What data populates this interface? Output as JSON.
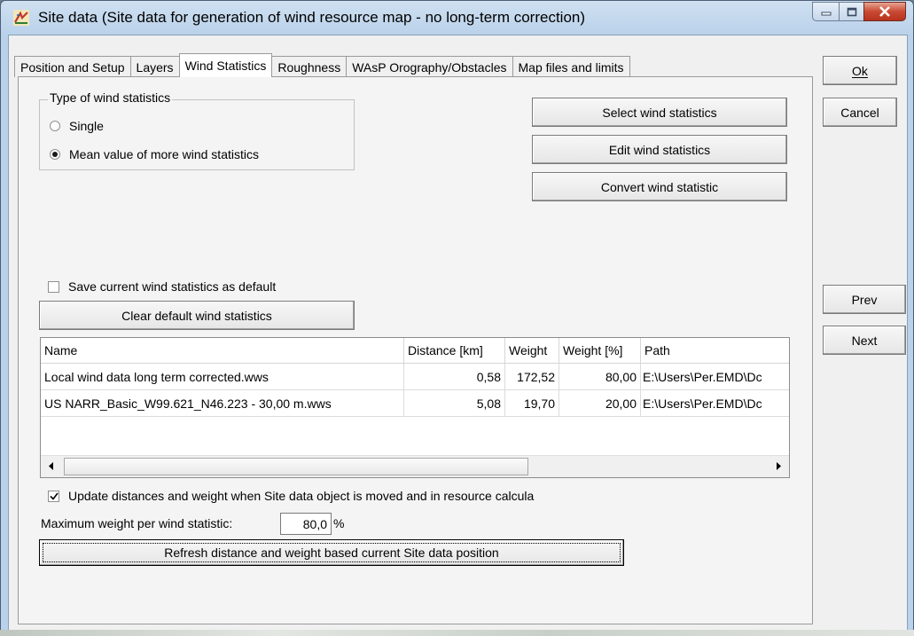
{
  "window": {
    "title": "Site data  (Site data for generation of wind resource map - no long-term correction)",
    "app_icon": "wind-app-icon"
  },
  "tabs": [
    {
      "label": "Position and Setup",
      "active": false
    },
    {
      "label": "Layers",
      "active": false
    },
    {
      "label": "Wind Statistics",
      "active": true
    },
    {
      "label": "Roughness",
      "active": false
    },
    {
      "label": "WAsP Orography/Obstacles",
      "active": false
    },
    {
      "label": "Map files and limits",
      "active": false
    }
  ],
  "side_buttons": {
    "ok": "Ok",
    "cancel": "Cancel",
    "prev": "Prev",
    "next": "Next"
  },
  "type_group": {
    "title": "Type of wind statistics",
    "options": [
      {
        "label": "Single",
        "selected": false
      },
      {
        "label": "Mean value of more wind statistics",
        "selected": true
      }
    ]
  },
  "actions": {
    "select": "Select wind statistics",
    "edit": "Edit wind statistics",
    "convert": "Convert wind statistic"
  },
  "default_settings": {
    "save_default_label": "Save current wind statistics as default",
    "save_default_checked": false,
    "clear_default": "Clear default wind statistics"
  },
  "table": {
    "columns": [
      "Name",
      "Distance [km]",
      "Weight",
      "Weight [%]",
      "Path"
    ],
    "rows": [
      [
        "Local wind data long term corrected.wws",
        "0,58",
        "172,52",
        "80,00",
        "E:\\Users\\Per.EMD\\Dc"
      ],
      [
        "US NARR_Basic_W99.621_N46.223 -  30,00 m.wws",
        "5,08",
        "19,70",
        "20,00",
        "E:\\Users\\Per.EMD\\Dc"
      ]
    ]
  },
  "update_option": {
    "label": "Update distances and weight when Site data object is moved and in resource calcula",
    "checked": true
  },
  "max_weight": {
    "label": "Maximum weight per wind statistic:",
    "value": "80,0",
    "unit": "%"
  },
  "refresh_button": "Refresh distance and weight based current Site data position"
}
